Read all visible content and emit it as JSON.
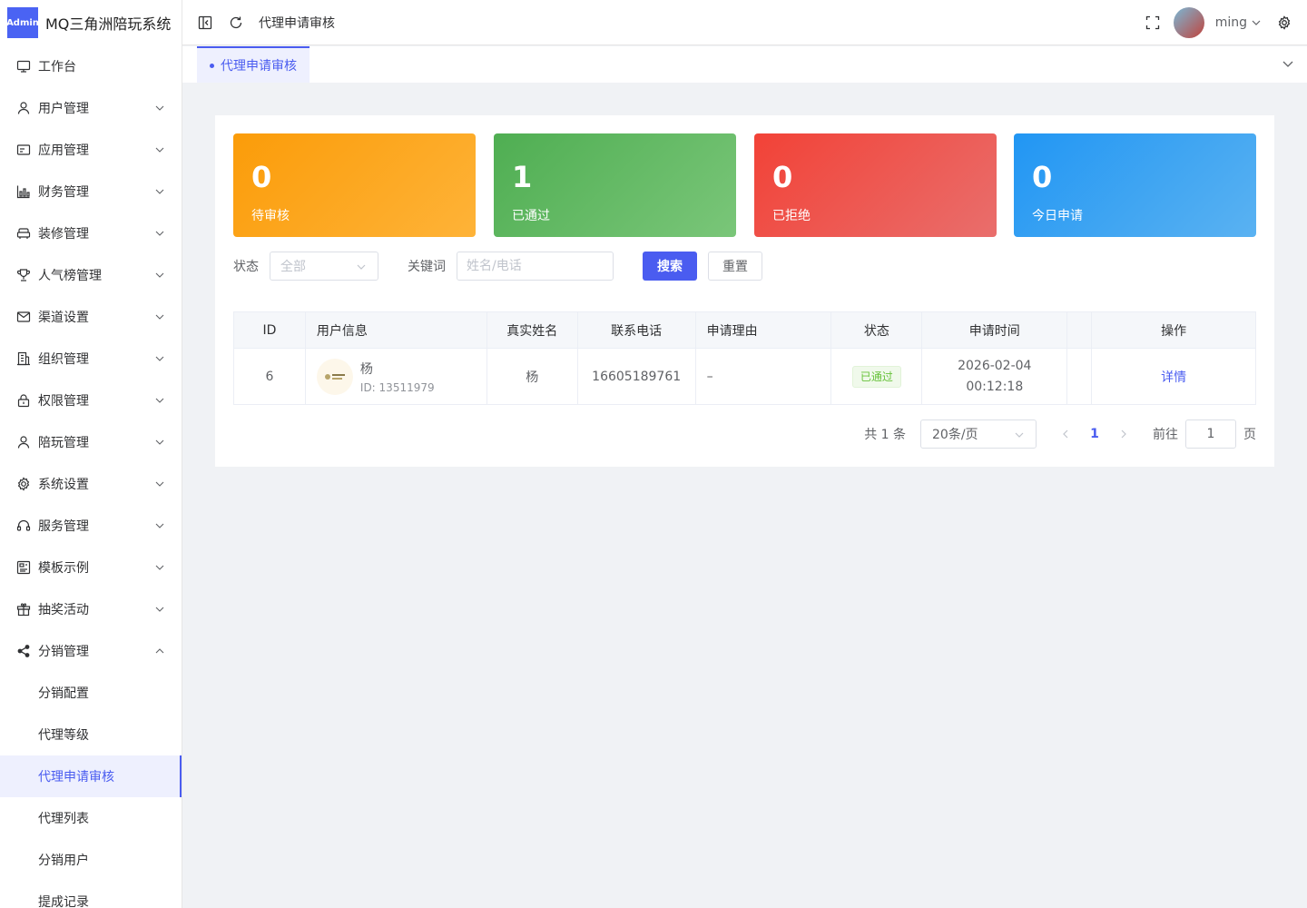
{
  "brand": {
    "logo": "Admin",
    "title": "MQ三角洲陪玩系统"
  },
  "sidebar": {
    "items": [
      {
        "label": "工作台",
        "icon": "monitor-icon",
        "arrow": false
      },
      {
        "label": "用户管理",
        "icon": "user-icon",
        "arrow": "down"
      },
      {
        "label": "应用管理",
        "icon": "card-icon",
        "arrow": "down"
      },
      {
        "label": "财务管理",
        "icon": "chart-icon",
        "arrow": "down"
      },
      {
        "label": "装修管理",
        "icon": "couch-icon",
        "arrow": "down"
      },
      {
        "label": "人气榜管理",
        "icon": "trophy-icon",
        "arrow": "down"
      },
      {
        "label": "渠道设置",
        "icon": "mail-icon",
        "arrow": "down"
      },
      {
        "label": "组织管理",
        "icon": "building-icon",
        "arrow": "down"
      },
      {
        "label": "权限管理",
        "icon": "lock-icon",
        "arrow": "down"
      },
      {
        "label": "陪玩管理",
        "icon": "user-icon",
        "arrow": "down"
      },
      {
        "label": "系统设置",
        "icon": "gear-icon",
        "arrow": "down"
      },
      {
        "label": "服务管理",
        "icon": "headset-icon",
        "arrow": "down"
      },
      {
        "label": "模板示例",
        "icon": "template-icon",
        "arrow": "down"
      },
      {
        "label": "抽奖活动",
        "icon": "gift-icon",
        "arrow": "down"
      },
      {
        "label": "分销管理",
        "icon": "share-icon",
        "arrow": "up"
      }
    ],
    "sub_items": [
      {
        "label": "分销配置",
        "active": false
      },
      {
        "label": "代理等级",
        "active": false
      },
      {
        "label": "代理申请审核",
        "active": true
      },
      {
        "label": "代理列表",
        "active": false
      },
      {
        "label": "分销用户",
        "active": false
      },
      {
        "label": "提成记录",
        "active": false
      }
    ]
  },
  "topbar": {
    "breadcrumb": "代理申请审核",
    "username": "ming"
  },
  "tabs": [
    {
      "label": "代理申请审核"
    }
  ],
  "stats": [
    {
      "value": "0",
      "label": "待审核"
    },
    {
      "value": "1",
      "label": "已通过"
    },
    {
      "value": "0",
      "label": "已拒绝"
    },
    {
      "value": "0",
      "label": "今日申请"
    }
  ],
  "filter": {
    "status_label": "状态",
    "status_value": "全部",
    "keyword_label": "关键词",
    "keyword_placeholder": "姓名/电话",
    "search_button": "搜索",
    "reset_button": "重置"
  },
  "table": {
    "headers": {
      "id": "ID",
      "user": "用户信息",
      "real_name": "真实姓名",
      "phone": "联系电话",
      "reason": "申请理由",
      "status": "状态",
      "time": "申请时间",
      "actions": "操作"
    },
    "rows": [
      {
        "id": "6",
        "name": "杨",
        "user_id": "ID: 13511979",
        "real_name": "杨",
        "phone": "16605189761",
        "reason": "–",
        "status": "已通过",
        "date": "2026-02-04",
        "clock": "00:12:18",
        "action": "详情"
      }
    ]
  },
  "pagination": {
    "total": "共 1 条",
    "page_size": "20条/页",
    "current": "1",
    "goto_label": "前往",
    "goto_value": "1",
    "page_suffix": "页"
  },
  "colors": {
    "accent": "#4a5cf0",
    "orange": "#fb9c09",
    "green": "#4fae52",
    "red": "#f24237",
    "blue": "#2196f3"
  }
}
